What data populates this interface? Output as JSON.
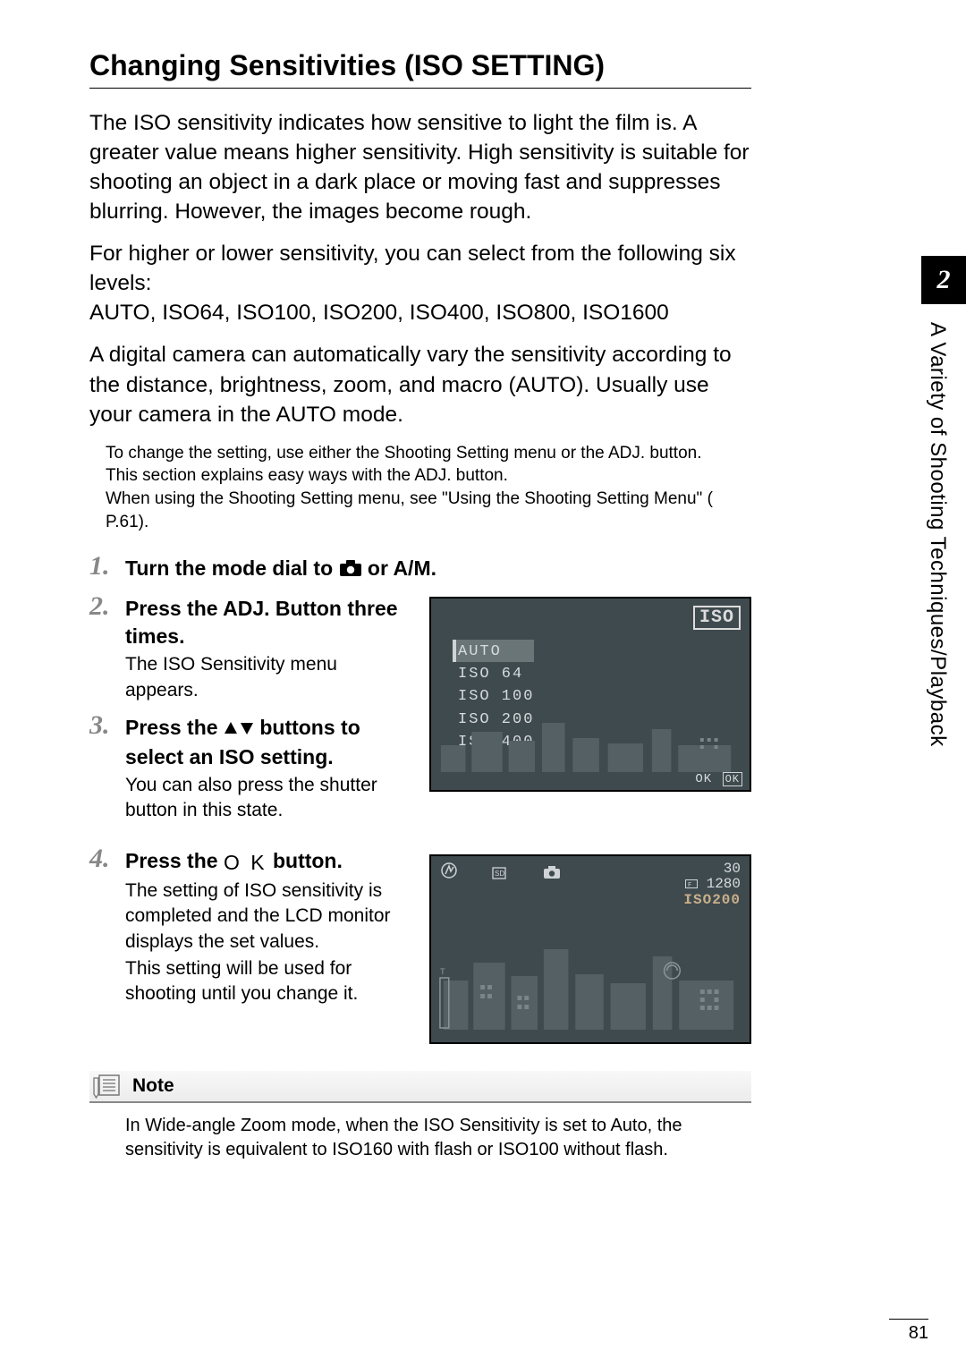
{
  "chapter": {
    "number": "2",
    "title": "A Variety of Shooting Techniques/Playback"
  },
  "page_number": "81",
  "title": "Changing Sensitivities (ISO SETTING)",
  "paragraphs": {
    "p1": "The ISO sensitivity indicates how sensitive to light the film is. A greater value means higher sensitivity. High sensitivity is suitable for shooting an object in a dark place or moving fast and suppresses blurring. However, the images become rough.",
    "p2": "For higher or lower sensitivity, you can select from the following six levels:",
    "p2b": "AUTO, ISO64, ISO100, ISO200, ISO400, ISO800, ISO1600",
    "p3": "A digital camera can automatically vary the sensitivity according to the distance, brightness, zoom, and macro (AUTO). Usually use your camera in the AUTO mode.",
    "note_small_1": "To change the setting, use either the Shooting Setting menu or the ADJ. button.",
    "note_small_2": "This section explains easy ways with the ADJ. button.",
    "note_small_3": "When using the Shooting Setting menu, see \"Using the Shooting Setting Menu\" ( P.61)."
  },
  "steps": {
    "s1": {
      "n": "1",
      "head_a": "Turn the mode dial to ",
      "head_b": " or A/M."
    },
    "s2": {
      "n": "2",
      "head": "Press the ADJ. Button three times.",
      "sub": "The ISO Sensitivity menu appears."
    },
    "s3": {
      "n": "3",
      "head_a": "Press the ",
      "head_b": " buttons to select an ISO setting.",
      "sub": "You can also press the shutter button in this state."
    },
    "s4": {
      "n": "4",
      "head_a": "Press the ",
      "head_b": " button.",
      "ok": "O K",
      "sub1": "The setting of ISO sensitivity is completed and the LCD monitor displays the set values.",
      "sub2": "This setting will be used for shooting until you change it."
    }
  },
  "lcd1": {
    "iso_tag": "ISO",
    "items": [
      "AUTO",
      "ISO  64",
      "ISO 100",
      "ISO 200",
      "ISO 400"
    ],
    "selected_index": 0,
    "ok": "OK",
    "ok_box": "OK"
  },
  "lcd2": {
    "shots": "30",
    "size": "1280",
    "iso": "ISO200"
  },
  "note": {
    "label": "Note",
    "body": "In Wide-angle Zoom mode, when the ISO Sensitivity is set to Auto, the sensitivity is equivalent to ISO160 with flash or ISO100 without flash."
  }
}
